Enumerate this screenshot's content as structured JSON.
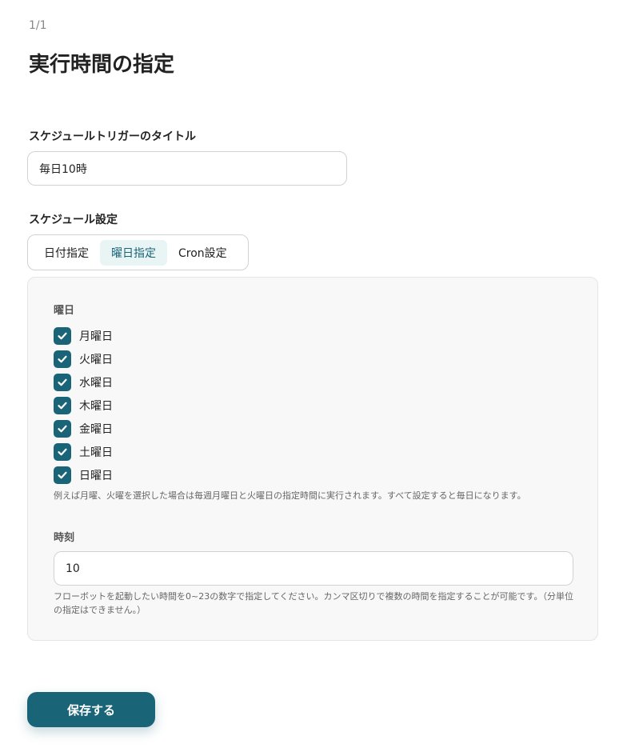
{
  "header": {
    "step": "1/1",
    "title": "実行時間の指定"
  },
  "trigger_title": {
    "label": "スケジュールトリガーのタイトル",
    "value": "毎日10時"
  },
  "schedule": {
    "label": "スケジュール設定",
    "tabs": [
      {
        "label": "日付指定",
        "active": false
      },
      {
        "label": "曜日指定",
        "active": true
      },
      {
        "label": "Cron設定",
        "active": false
      }
    ]
  },
  "weekday_panel": {
    "days_label": "曜日",
    "days": [
      {
        "label": "月曜日",
        "checked": true
      },
      {
        "label": "火曜日",
        "checked": true
      },
      {
        "label": "水曜日",
        "checked": true
      },
      {
        "label": "木曜日",
        "checked": true
      },
      {
        "label": "金曜日",
        "checked": true
      },
      {
        "label": "土曜日",
        "checked": true
      },
      {
        "label": "日曜日",
        "checked": true
      }
    ],
    "days_hint": "例えば月曜、火曜を選択した場合は毎週月曜日と火曜日の指定時間に実行されます。すべて設定すると毎日になります。",
    "time_label": "時刻",
    "time_value": "10",
    "time_hint": "フローボットを起動したい時間を0~23の数字で指定してください。カンマ区切りで複数の時間を指定することが可能です。（分単位の指定はできません。）"
  },
  "footer": {
    "save_label": "保存する"
  },
  "colors": {
    "accent": "#1a6478",
    "tab_active_bg": "#e9f4f5",
    "panel_bg": "#f8f8f8"
  }
}
